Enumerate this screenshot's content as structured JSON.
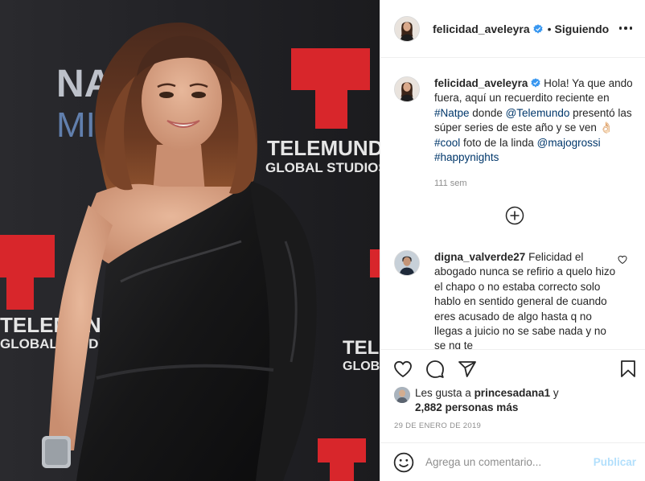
{
  "colors": {
    "accent": "#0095f6",
    "hashtag": "#00376b",
    "muted": "#8e8e8e",
    "publish_disabled": "#b2dffc",
    "backdrop_red": "#d8262b"
  },
  "photo": {
    "backdrop_logos": [
      "NAT",
      "MI",
      "TELEMUNDO",
      "GLOBAL STUDIOS",
      "TELEMUNDO",
      "GLOBAL STUDIOS",
      "TELE",
      "GLOBAL"
    ]
  },
  "header": {
    "username": "felicidad_aveleyra",
    "separator": "•",
    "follow_status": "Siguiendo",
    "icons": [
      "verified-badge-icon",
      "more-options-icon"
    ]
  },
  "caption": {
    "username": "felicidad_aveleyra",
    "t1": " Hola! Ya que ando fuera, aquí un recuerdito reciente en ",
    "tag_natpe": "#Natpe",
    "t2": " donde ",
    "mention_telemundo": "@Telemundo",
    "t3": " presentó las súper series de este año y se ven ",
    "emoji": "👌🏻",
    "tag_cool": "#cool",
    "t4": " foto de la linda ",
    "mention_majo": "@majogrossi",
    "t5": " ",
    "tag_happy": "#happynights",
    "age": "111 sem"
  },
  "comment": {
    "username": "digna_valverde27",
    "text": " Felicidad el abogado nunca se refirio a quelo hizo el chapo o no estaba correcto solo hablo en sentido general de cuando eres acusado de algo hasta q no llegas a juicio no se sabe nada y no se ng te"
  },
  "actions": {
    "icons": [
      "like-heart-icon",
      "comment-bubble-icon",
      "share-plane-icon",
      "save-bookmark-icon"
    ]
  },
  "likes": {
    "prefix": "Les gusta a ",
    "user": "princesadana1",
    "mid": " y ",
    "count": "2,882 personas más"
  },
  "date": "29 DE ENERO DE 2019",
  "composer": {
    "placeholder": "Agrega un comentario...",
    "publish_label": "Publicar"
  }
}
